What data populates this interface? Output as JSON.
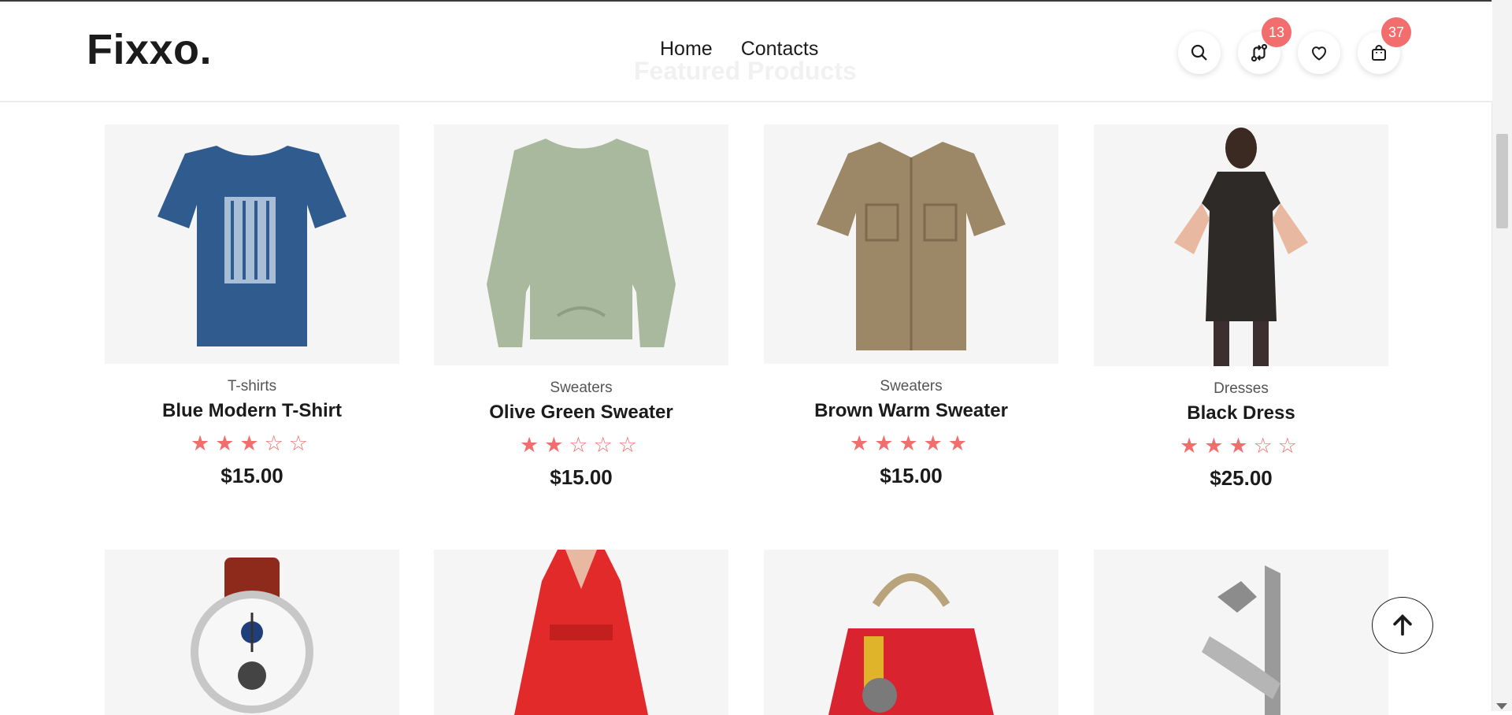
{
  "brand": {
    "logo": "Fixxo."
  },
  "section": {
    "title": "Featured Products"
  },
  "nav": {
    "home": "Home",
    "contacts": "Contacts"
  },
  "header_icons": {
    "search": "search-icon",
    "compare": {
      "icon": "compare-icon",
      "badge": "13"
    },
    "wishlist": "heart-icon",
    "cart": {
      "icon": "shopping-bag-icon",
      "badge": "37"
    }
  },
  "colors": {
    "accent": "#f26d6d",
    "text": "#1b1b1b",
    "card_bg": "#f5f5f5"
  },
  "products": [
    {
      "category": "T-shirts",
      "name": "Blue Modern T-Shirt",
      "stars": "★★★☆☆",
      "rating": 3,
      "price": "$15.00"
    },
    {
      "category": "Sweaters",
      "name": "Olive Green Sweater",
      "stars": "★★☆☆☆",
      "rating": 2,
      "price": "$15.00"
    },
    {
      "category": "Sweaters",
      "name": "Brown Warm Sweater",
      "stars": "★★★★★",
      "rating": 5,
      "price": "$15.00"
    },
    {
      "category": "Dresses",
      "name": "Black Dress",
      "stars": "★★★☆☆",
      "rating": 3,
      "price": "$25.00"
    }
  ],
  "products_row2": [
    {
      "image": "watch-image"
    },
    {
      "image": "red-dress-image"
    },
    {
      "image": "red-handbag-image"
    },
    {
      "image": "silver-heels-image"
    }
  ],
  "scroll_top": {
    "icon": "arrow-up-icon"
  }
}
